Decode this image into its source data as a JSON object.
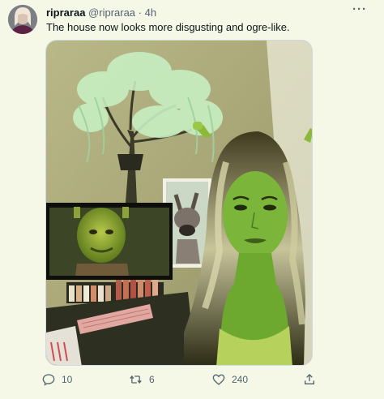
{
  "tweet": {
    "display_name": "ripraraa",
    "handle": "@ripraraa",
    "separator": "·",
    "time": "4h",
    "text": "The house now looks more disgusting and ogre-like.",
    "more_icon": "more-horizontal-icon"
  },
  "actions": {
    "reply_count": "10",
    "retweet_count": "6",
    "like_count": "240",
    "reply_icon": "reply-icon",
    "retweet_icon": "retweet-icon",
    "like_icon": "heart-icon",
    "share_icon": "share-icon"
  },
  "colors": {
    "background": "#f5f8e6",
    "text_primary": "#0f1419",
    "text_secondary": "#536471",
    "green_tint": "#7ec23a"
  }
}
